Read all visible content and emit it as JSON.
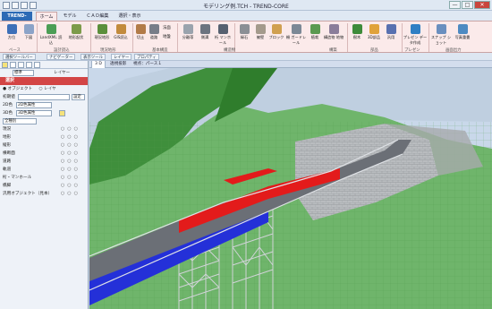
{
  "window": {
    "title": "モデリング例.TCH - TREND-CORE",
    "min": "—",
    "max": "□",
    "close": "✕"
  },
  "app_button": "TREND-CORE",
  "tabs": [
    {
      "label": "ホーム",
      "active": true
    },
    {
      "label": "モデル",
      "active": false
    },
    {
      "label": "ＣＡＤ編集",
      "active": false
    },
    {
      "label": "選択・表示",
      "active": false
    }
  ],
  "ribbon": {
    "buttons": [
      "方位",
      "下図",
      "LandXML 読込",
      "地形起伏",
      "現況地形",
      "GIS読込",
      "切土",
      "盛土",
      "横断",
      "道路",
      "法面",
      "分離帯",
      "側溝",
      "桁 マンホール",
      "縁石",
      "擁壁",
      "ブロック",
      "柵 ガードレール",
      "植栽",
      "構造物 地物",
      "樹木",
      "3D部品",
      "汎用",
      "プレゼン データ作成",
      "スナップ ショット",
      "写真重畳"
    ],
    "groups": [
      "ベース",
      "設計読込",
      "現況地形",
      "基本構造",
      "構造物",
      "構築",
      "部品",
      "プレゼン",
      "画面出力"
    ],
    "small": [
      "法面",
      "地盤"
    ]
  },
  "toolbar2": {
    "items": [
      "選択ツールバー",
      "ナビゲーター",
      "表示ツール",
      "レイヤー",
      "プロパティ"
    ]
  },
  "sidebar": {
    "std_label": "標準",
    "layer_label": "レイヤー",
    "section": "選択",
    "radio_object": "オブジェクト",
    "radio_layer": "レイヤ",
    "initial_label": "初期値",
    "set_label": "設定",
    "sel2d": "2D色",
    "sel2d_val": "2D色属性",
    "sel3d": "3D色",
    "sel3d_val": "3D色属性",
    "all_types": "全種別",
    "items": [
      {
        "label": "現況"
      },
      {
        "label": "地形"
      },
      {
        "label": "縦形"
      },
      {
        "label": "横断面"
      },
      {
        "label": "道路"
      },
      {
        "label": "軌道"
      },
      {
        "label": "桁・マンホール"
      },
      {
        "label": "橋脚"
      },
      {
        "label": "汎用オブジェクト（見本）"
      }
    ]
  },
  "viewport": {
    "tabs": [
      "3 D",
      "透視投影",
      "視点：パース１"
    ]
  },
  "colors": {
    "sky": "#c9d8ea",
    "terrain": "#6fb56b",
    "dark_terrain": "#3f8f3c",
    "deck": "#6b6f76",
    "red": "#e31b1b",
    "blue": "#2430d8"
  }
}
